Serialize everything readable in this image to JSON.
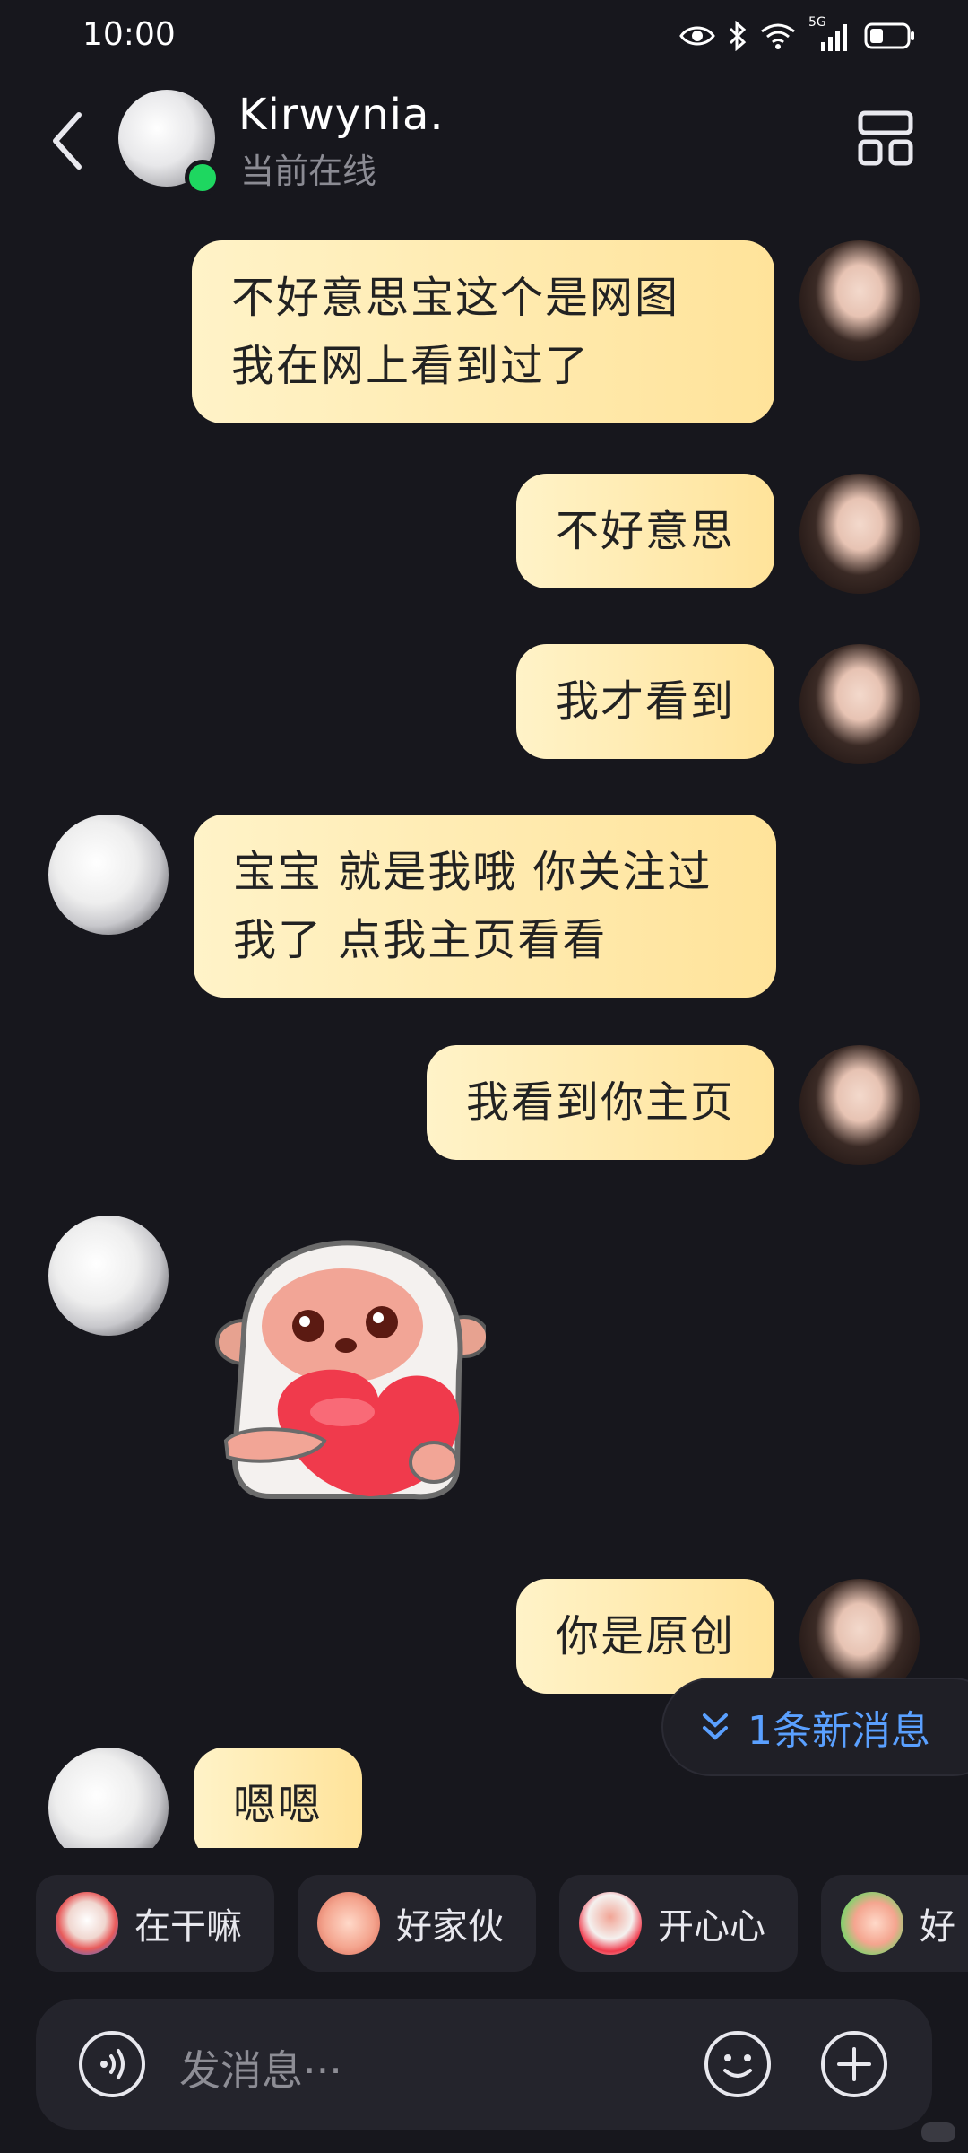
{
  "status_bar": {
    "time": "10:00",
    "network_label": "5G",
    "icons": [
      "eye-icon",
      "bluetooth-icon",
      "wifi-icon",
      "signal-icon",
      "battery-icon"
    ]
  },
  "header": {
    "contact_name": "Kirwynia.",
    "contact_status": "当前在线",
    "online_color": "#1ed760"
  },
  "messages": [
    {
      "from": "me",
      "lines": [
        "不好意思宝这个是网图",
        "我在网上看到过了"
      ]
    },
    {
      "from": "me",
      "lines": [
        "不好意思"
      ]
    },
    {
      "from": "me",
      "lines": [
        "我才看到"
      ]
    },
    {
      "from": "them",
      "lines": [
        "宝宝 就是我哦 你关注过",
        "我了 点我主页看看"
      ]
    },
    {
      "from": "me",
      "lines": [
        "我看到你主页"
      ]
    },
    {
      "from": "them",
      "sticker": "hug-heart-sticker-icon"
    },
    {
      "from": "me",
      "lines": [
        "你是原创"
      ]
    },
    {
      "from": "them",
      "lines": [
        "嗯嗯"
      ]
    }
  ],
  "new_message_pill": "1条新消息",
  "quick_replies": [
    "在干嘛",
    "好家伙",
    "开心心",
    "好"
  ],
  "input": {
    "placeholder": "发消息···"
  },
  "colors": {
    "background": "#17171d",
    "bubble_start": "#fff3c8",
    "bubble_end": "#ffe39a",
    "accent_blue": "#5aa0ff"
  }
}
